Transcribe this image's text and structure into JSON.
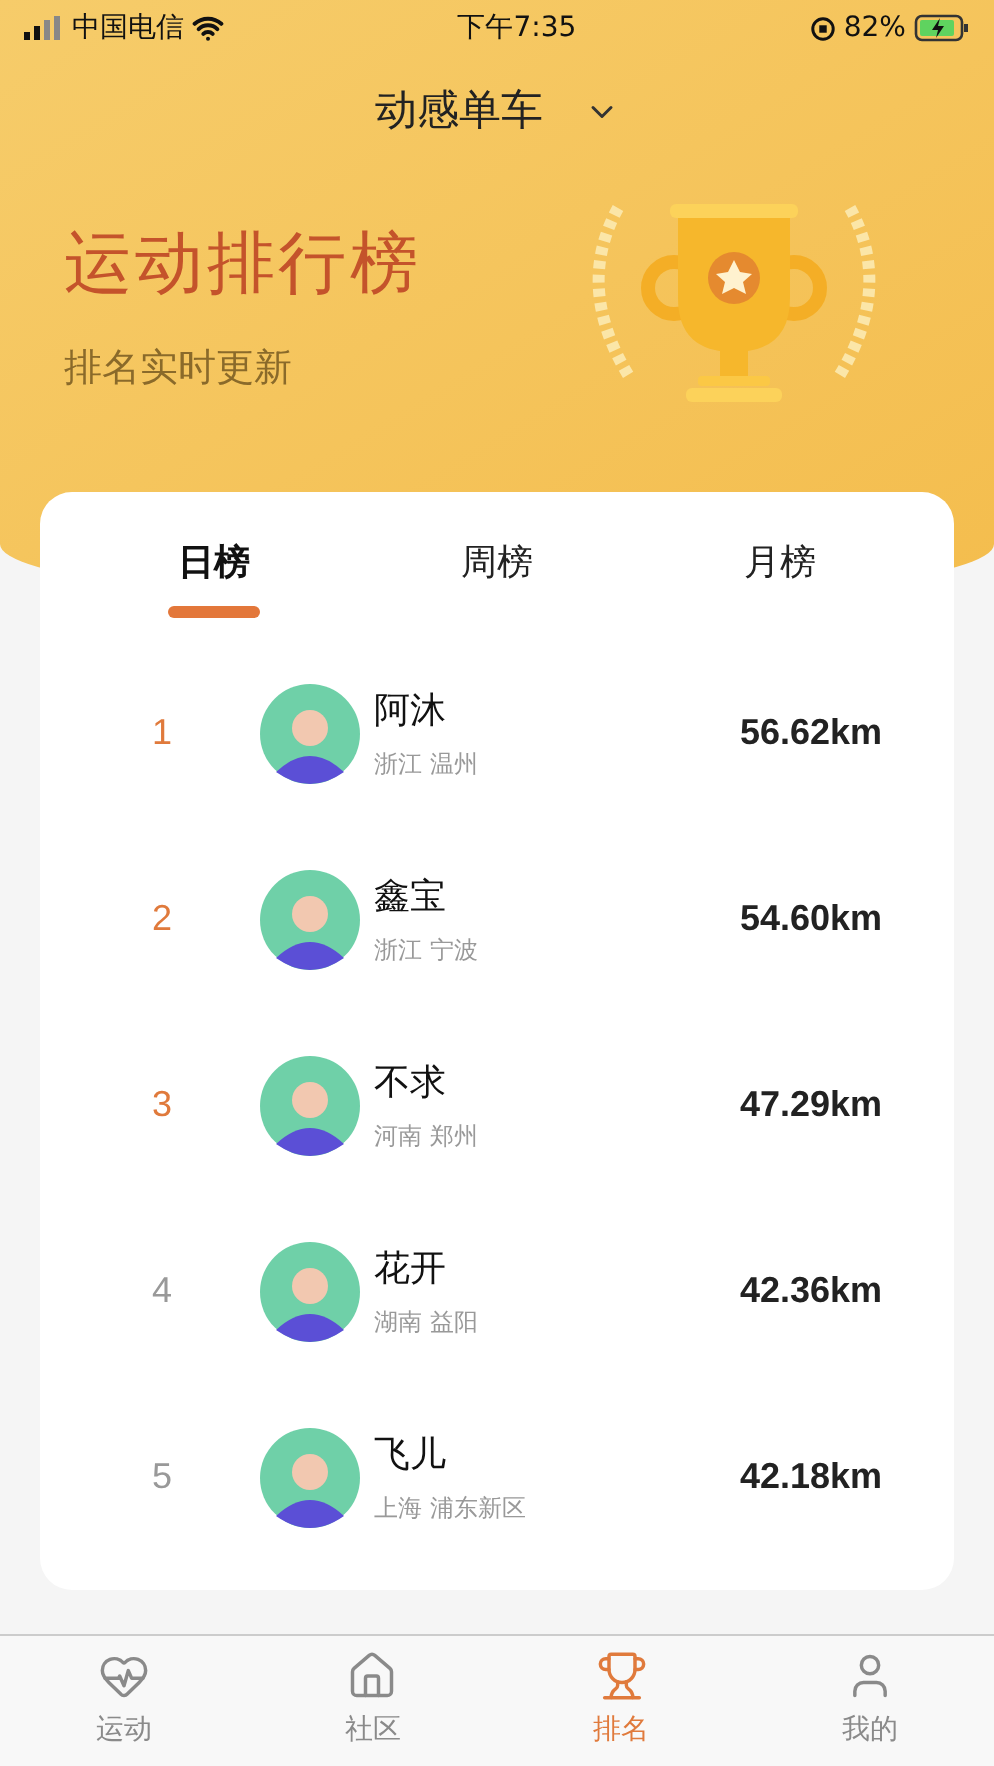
{
  "status_bar": {
    "carrier": "中国电信",
    "time": "下午7:35",
    "battery": "82%"
  },
  "title": {
    "text": "动感单车"
  },
  "banner": {
    "heading": "运动排行榜",
    "subheading": "排名实时更新"
  },
  "tabs": [
    {
      "label": "日榜",
      "selected": true
    },
    {
      "label": "周榜",
      "selected": false
    },
    {
      "label": "月榜",
      "selected": false
    }
  ],
  "ranking": [
    {
      "rank": "1",
      "top": true,
      "name": "阿沐",
      "location": "浙江 温州",
      "distance": "56.62km"
    },
    {
      "rank": "2",
      "top": true,
      "name": "鑫宝",
      "location": "浙江 宁波",
      "distance": "54.60km"
    },
    {
      "rank": "3",
      "top": true,
      "name": "不求",
      "location": "河南 郑州",
      "distance": "47.29km"
    },
    {
      "rank": "4",
      "top": false,
      "name": "花开",
      "location": "湖南 益阳",
      "distance": "42.36km"
    },
    {
      "rank": "5",
      "top": false,
      "name": "飞儿",
      "location": "上海 浦东新区",
      "distance": "42.18km"
    }
  ],
  "bottom_nav": [
    {
      "label": "运动",
      "selected": false
    },
    {
      "label": "社区",
      "selected": false
    },
    {
      "label": "排名",
      "selected": true
    },
    {
      "label": "我的",
      "selected": false
    }
  ]
}
